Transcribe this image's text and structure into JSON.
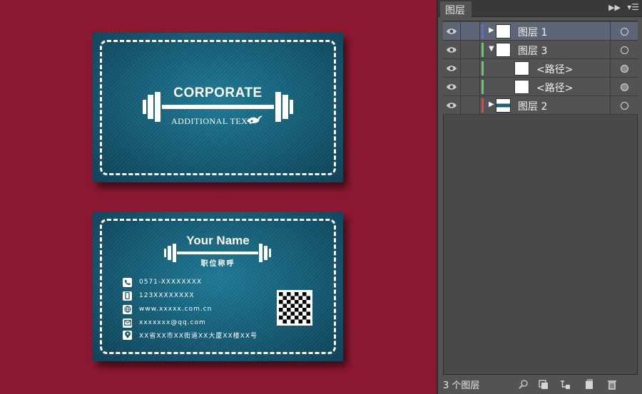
{
  "front_card": {
    "brand": "CORPORATE",
    "subtitle": "ADDITIONAL TEXT"
  },
  "back_card": {
    "name": "Your Name",
    "title": "职位称呼",
    "contacts": [
      {
        "icon": "phone-icon",
        "text": "0571-XXXXXXXX"
      },
      {
        "icon": "mobile-icon",
        "text": "123XXXXXXXX"
      },
      {
        "icon": "web-icon",
        "text": "www.xxxxx.com.cn"
      },
      {
        "icon": "mail-icon",
        "text": "xxxxxxx@qq.com"
      },
      {
        "icon": "location-icon",
        "text": "XX省XX市XX街道XX大厦XX楼XX号"
      }
    ]
  },
  "layers_panel": {
    "tab_label": "图层",
    "collapse_label": "▶▶",
    "menu_label": "▾☰",
    "layers": [
      {
        "name": "图层 1",
        "color": "#4f6ed6",
        "expand": "▶",
        "selected": true,
        "target": "empty"
      },
      {
        "name": "图层 3",
        "color": "#5bd35b",
        "expand": "▼",
        "selected": false,
        "target": "empty"
      },
      {
        "name": "<路径>",
        "color": "#5bd35b",
        "expand": "",
        "selected": false,
        "target": "filled"
      },
      {
        "name": "<路径>",
        "color": "#5bd35b",
        "expand": "",
        "selected": false,
        "target": "filled"
      },
      {
        "name": "图层 2",
        "color": "#e0454b",
        "expand": "▶",
        "selected": false,
        "target": "empty"
      }
    ],
    "footer_count": "3 个图层",
    "footer_tools": [
      "locate-object-icon",
      "clipping-mask-icon",
      "new-sublayer-icon",
      "new-layer-icon",
      "delete-icon"
    ]
  },
  "colors": {
    "canvas_bg": "#8d1832",
    "card_teal": "#16607a",
    "panel_bg": "#535353"
  }
}
